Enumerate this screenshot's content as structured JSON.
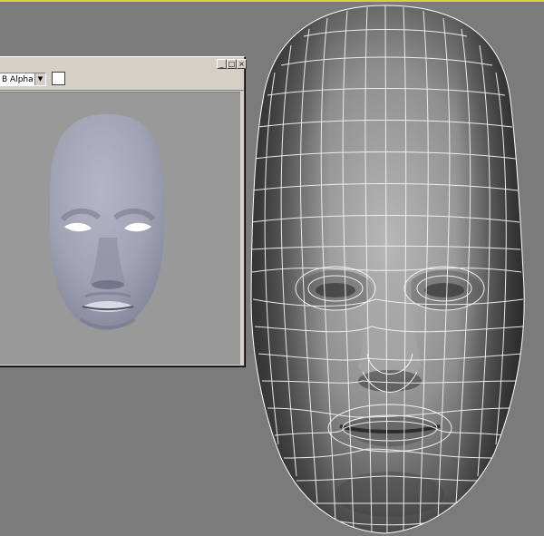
{
  "render_window": {
    "channel_select": "B Alpha",
    "controls": {
      "minimize": "_",
      "maximize": "□",
      "close": "×"
    },
    "swatch_color": "#ffffff"
  },
  "viewport": {
    "background": "#7b7b7b",
    "highlight_color": "#d7d43a"
  }
}
